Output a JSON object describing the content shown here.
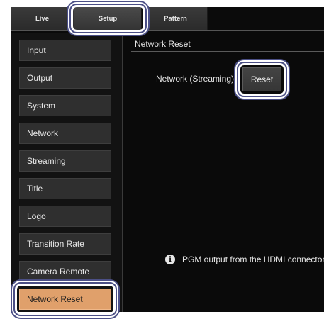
{
  "tabs": [
    {
      "label": "Live"
    },
    {
      "label": "Setup"
    },
    {
      "label": "Pattern"
    }
  ],
  "sidebar": {
    "items": [
      {
        "label": "Input"
      },
      {
        "label": "Output"
      },
      {
        "label": "System"
      },
      {
        "label": "Network"
      },
      {
        "label": "Streaming"
      },
      {
        "label": "Title"
      },
      {
        "label": "Logo"
      },
      {
        "label": "Transition Rate"
      },
      {
        "label": "Camera Remote"
      },
      {
        "label": "Network Reset",
        "active": true
      }
    ]
  },
  "main": {
    "section_title": "Network Reset",
    "field_label": "Network (Streaming)",
    "reset_label": "Reset",
    "info_text": "PGM output from the HDMI connector wi",
    "info_icon": "info-icon"
  },
  "colors": {
    "active_item": "#e0a06b",
    "highlight_border": "#4b4f86",
    "background": "#0a0a0a"
  }
}
